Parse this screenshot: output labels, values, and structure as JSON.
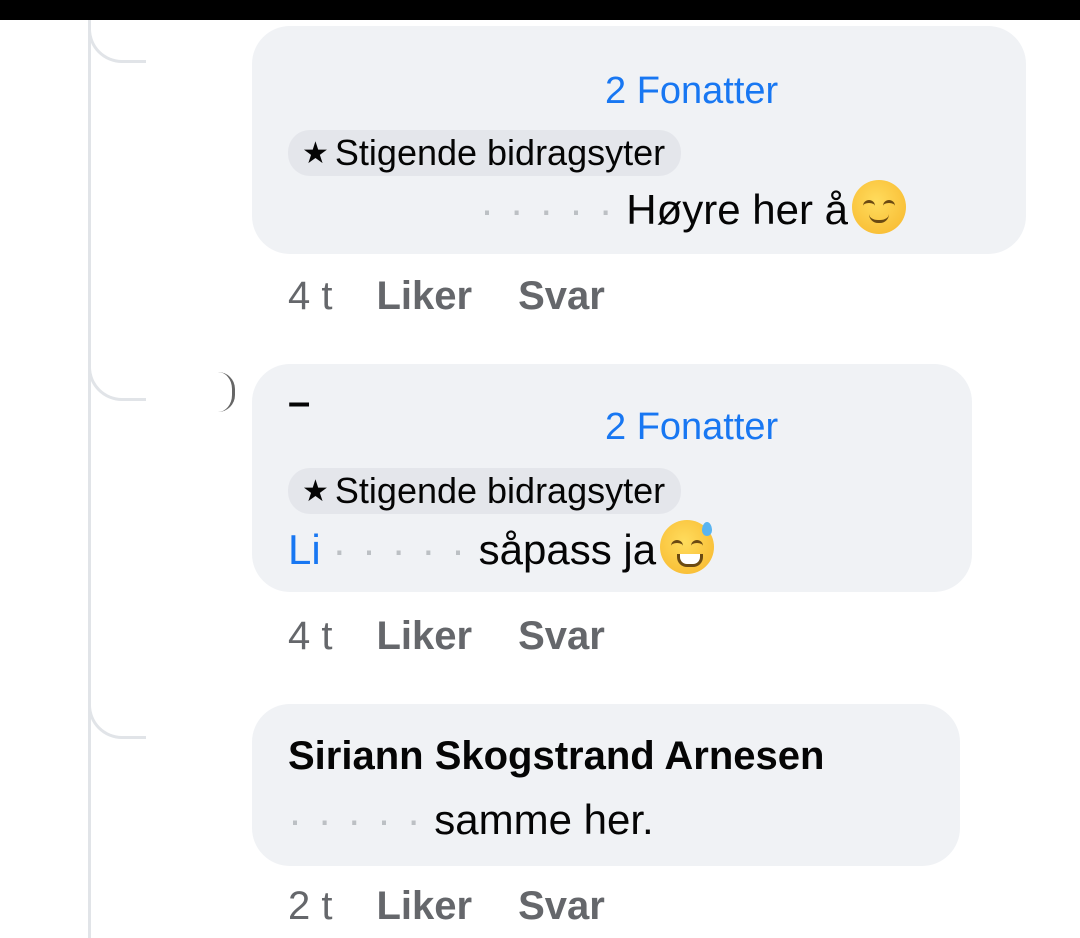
{
  "comments": [
    {
      "author": "",
      "tag": "2 Fonatter",
      "badge": "Stigende bidragsyter",
      "redacted_prefix": "· · · · ·",
      "text": "Høyre her å",
      "time": "4 t",
      "like_label": "Liker",
      "reply_label": "Svar"
    },
    {
      "author": "–",
      "tag": "2 Fonatter",
      "badge": "Stigende bidragsyter",
      "mention": "Li",
      "redacted_prefix": "· · · · ·",
      "text": "såpass ja",
      "time": "4 t",
      "like_label": "Liker",
      "reply_label": "Svar"
    },
    {
      "author": "Siriann Skogstrand Arnesen",
      "redacted_prefix": "· · · · ·",
      "text": "samme her.",
      "time": "2 t",
      "like_label": "Liker",
      "reply_label": "Svar"
    }
  ],
  "icons": {
    "star": "star-icon",
    "pensive_emoji": "pensive-face-emoji",
    "sweat_smile_emoji": "grinning-sweat-emoji"
  }
}
